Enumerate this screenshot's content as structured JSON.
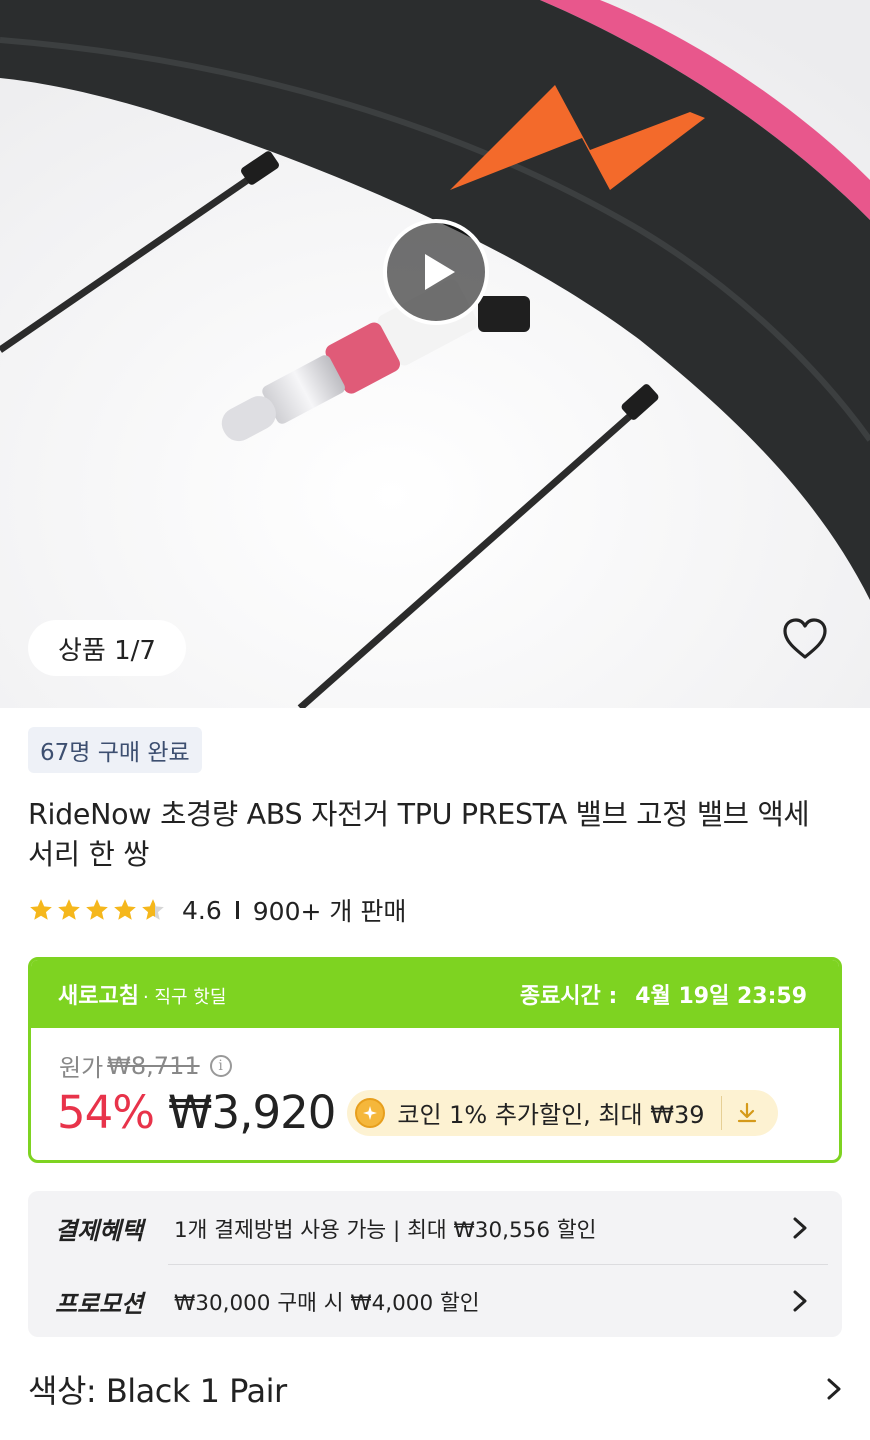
{
  "gallery": {
    "counter": "상품 1/7",
    "play_icon": "play-icon",
    "wishlist_icon": "heart-outline-icon"
  },
  "product": {
    "sold_badge": "67명 구매 완료",
    "title": "RideNow 초경량 ABS 자전거 TPU PRESTA 밸브 고정 밸브 액세서리 한 쌍",
    "rating": 4.6,
    "rating_label": "4.6",
    "sold_count": "900+ 개 판매"
  },
  "deal": {
    "brand": "새로고침",
    "sub": "· 직구 핫딜",
    "end_label": "종료시간 :",
    "end_time": "4월 19일 23:59",
    "original_label": "원가",
    "original_price": "₩8,711",
    "discount": "54%",
    "price": "₩3,920",
    "coin_text": "코인 1% 추가할인, 최대 ₩39",
    "colors": {
      "accent": "#7ed321",
      "discount": "#e8334a",
      "coin_bg": "#fdf2d2"
    }
  },
  "benefits": [
    {
      "label": "결제혜택",
      "text": "1개 결제방법 사용 가능 | 최대 ₩30,556 할인"
    },
    {
      "label": "프로모션",
      "text": "₩30,000 구매 시 ₩4,000 할인"
    }
  ],
  "option": {
    "text": "색상: Black 1 Pair"
  }
}
